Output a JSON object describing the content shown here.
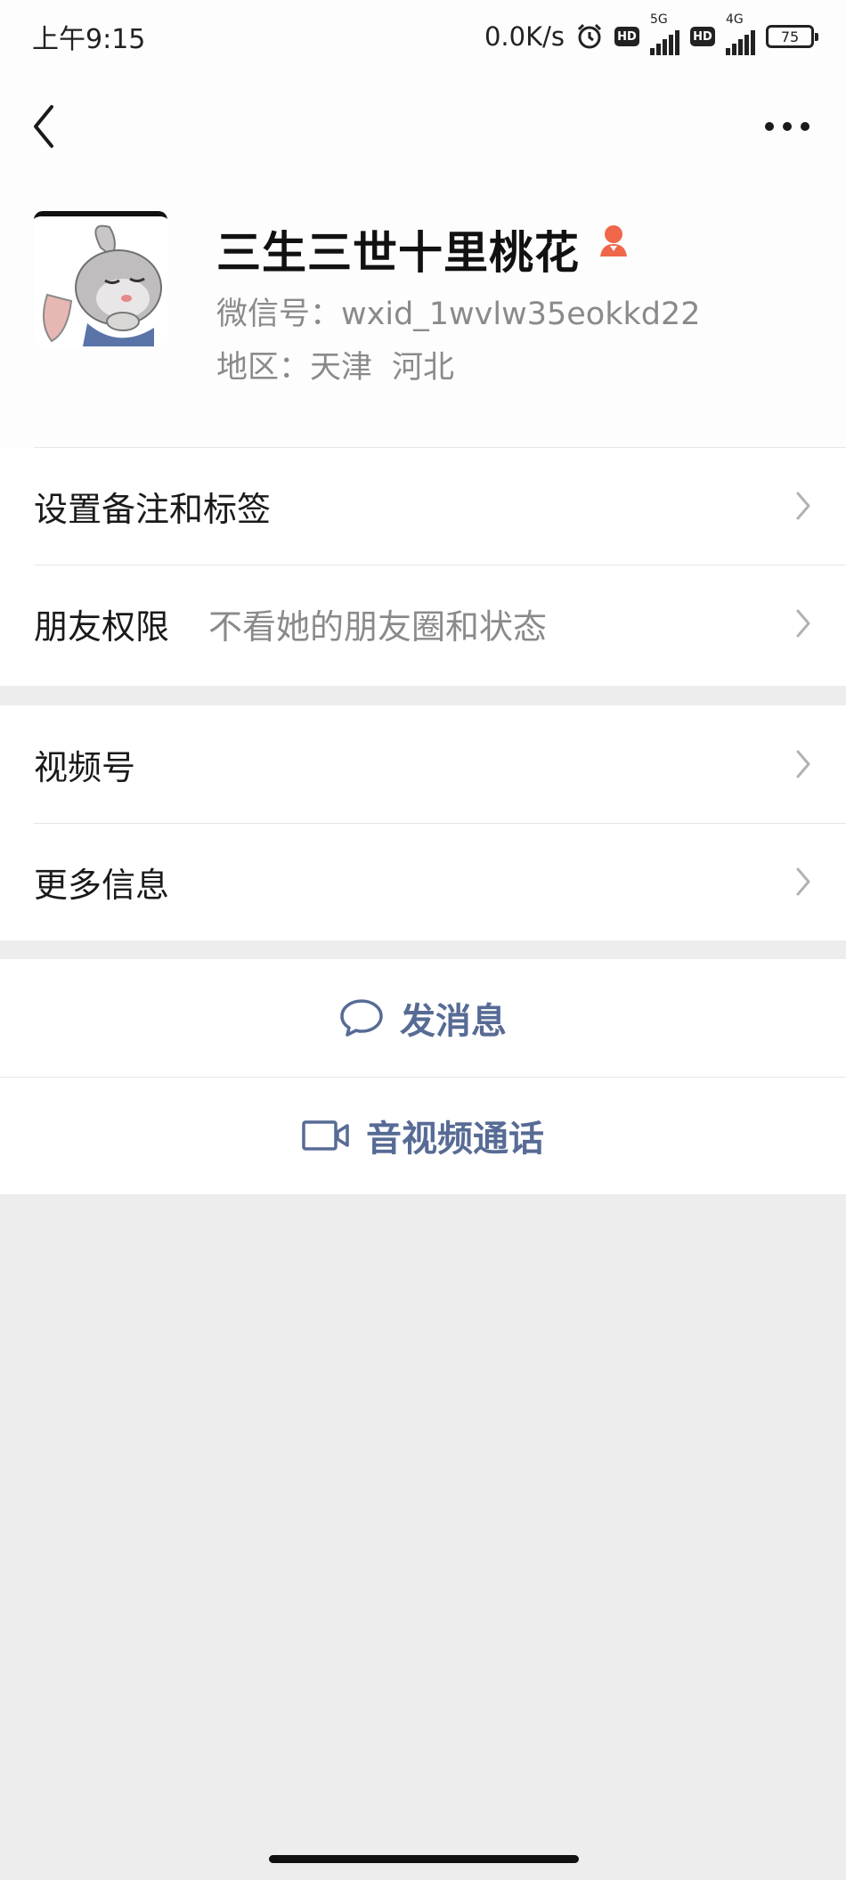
{
  "status_bar": {
    "time": "上午9:15",
    "network_speed": "0.0K/s",
    "hd_label": "HD",
    "sim1_type": "5G",
    "sim2_type": "4G",
    "battery": "75"
  },
  "profile": {
    "nickname": "三生三世十里桃花",
    "wxid": "微信号：wxid_1wvlw35eokkd22",
    "region_label": "地区：",
    "region_city": "天津",
    "region_province": "河北",
    "gender": "female",
    "gender_color": "#f0664a"
  },
  "rows": {
    "remark": "设置备注和标签",
    "permission_label": "朋友权限",
    "permission_value": "不看她的朋友圈和状态",
    "channels": "视频号",
    "more_info": "更多信息"
  },
  "actions": {
    "message": "发消息",
    "call": "音视频通话",
    "accent_color": "#576b95"
  }
}
